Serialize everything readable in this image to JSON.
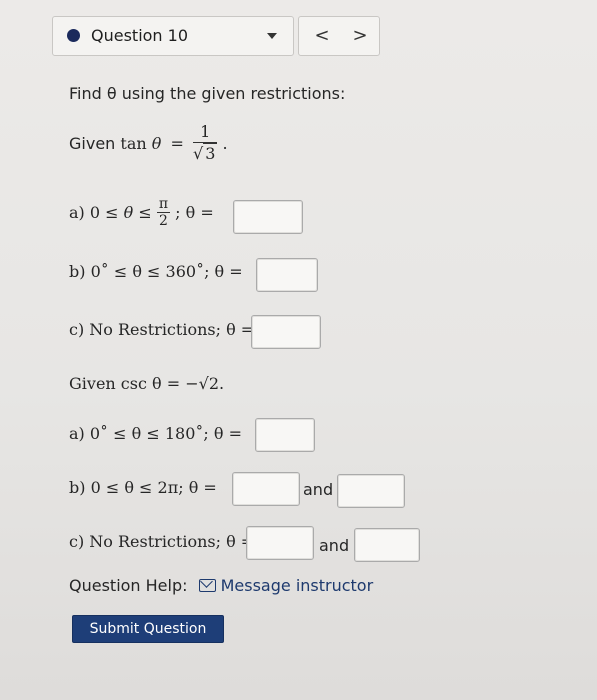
{
  "question": {
    "label": "Question 10"
  },
  "nav": {
    "prev": "<",
    "next": ">"
  },
  "prompt": "Find θ using the given restrictions:",
  "given1": {
    "prefix": "Given",
    "func": "tan",
    "var": "θ",
    "eq": "=",
    "numerator": "1",
    "denominator_radicand": "3",
    "sqrt_symbol": "√",
    "trail": "."
  },
  "parts1": {
    "a": {
      "prefix": "a) 0 ≤",
      "var": "θ",
      "mid": "≤",
      "frac_num": "π",
      "frac_den": "2",
      "suffix": "; θ ="
    },
    "b": {
      "text": "b) 0˚ ≤ θ ≤ 360˚; θ ="
    },
    "c": {
      "text": "c) No Restrictions; θ ="
    }
  },
  "given2": {
    "text": "Given csc θ = −√2."
  },
  "parts2": {
    "a": {
      "text": "a) 0˚ ≤ θ ≤ 180˚; θ ="
    },
    "b": {
      "text": "b) 0 ≤ θ ≤ 2π; θ =",
      "and": "and"
    },
    "c": {
      "text": "c) No Restrictions; θ =",
      "and": "and"
    }
  },
  "help": {
    "label": "Question Help:",
    "link": "Message instructor",
    "link_icon": "mail-icon"
  },
  "submit": {
    "label": "Submit Question"
  },
  "colors": {
    "accent": "#1e3e78",
    "dot": "#1b2a5c"
  }
}
